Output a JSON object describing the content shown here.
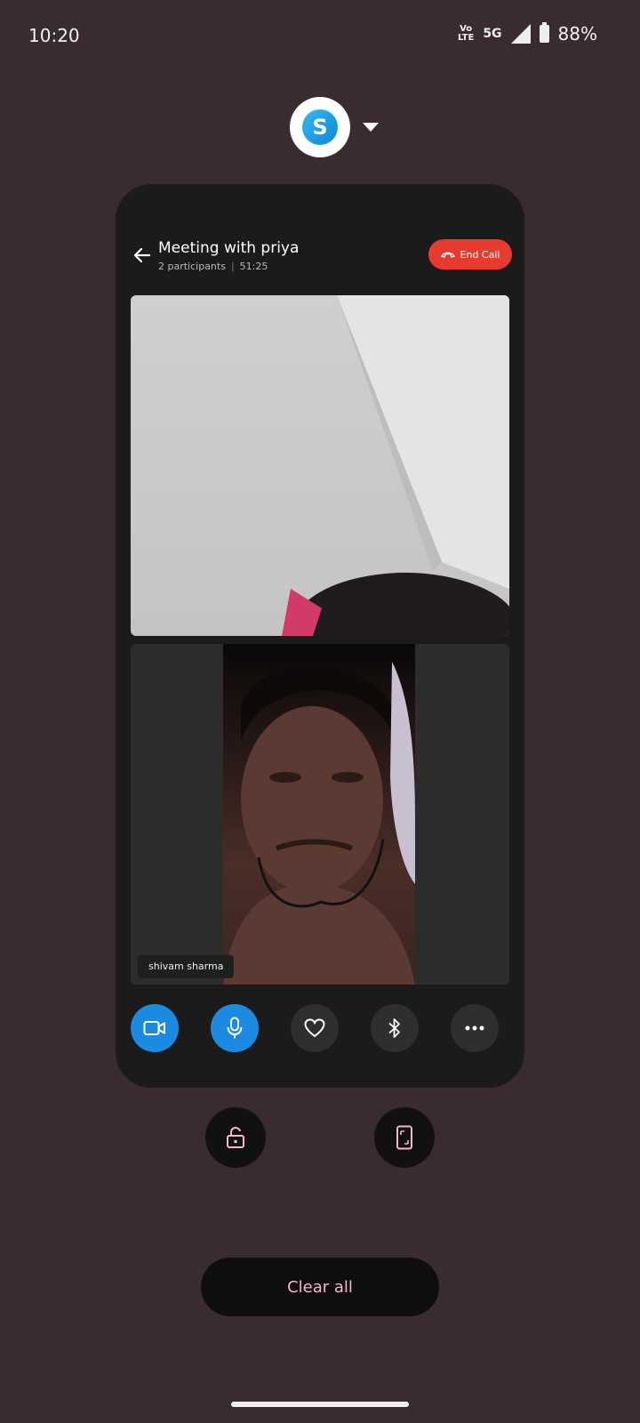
{
  "status_bar": {
    "time": "10:20",
    "volte_line1": "Vo",
    "volte_line2": "LTE",
    "network": "5G",
    "battery": "88%"
  },
  "recents": {
    "app_name_icon": "skype-icon",
    "clear_all_label": "Clear all"
  },
  "call": {
    "title": "Meeting with priya",
    "participants": "2 participants",
    "duration": "51:25",
    "end_call_label": "End Call",
    "remote_name": "shivam sharma"
  },
  "colors": {
    "end_call": "#e63b2e",
    "active_control": "#1a8be0",
    "accent_pink": "#f4b6c8"
  }
}
